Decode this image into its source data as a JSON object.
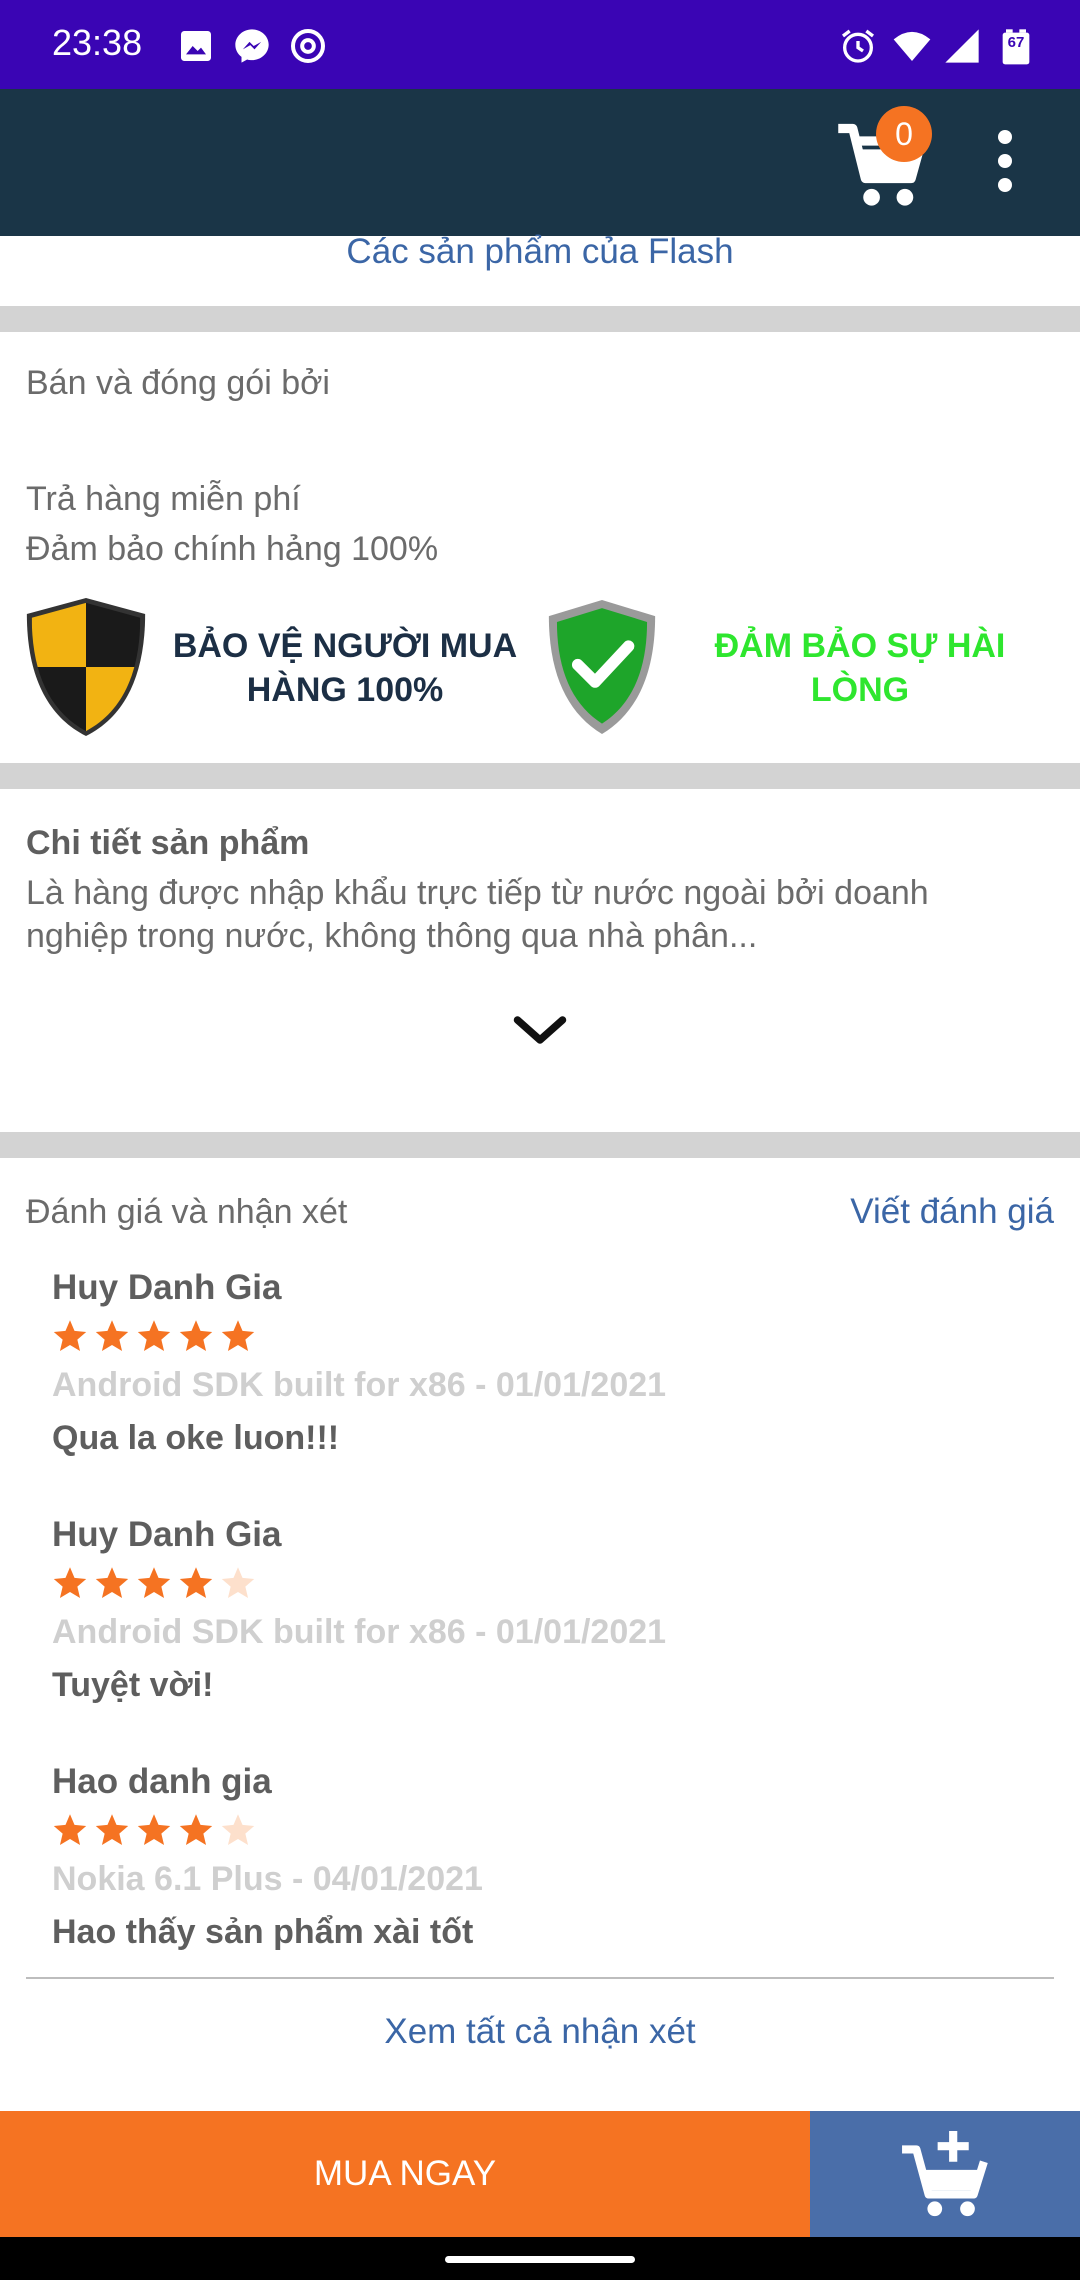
{
  "status_bar": {
    "time": "23:38",
    "battery": "67",
    "background": "#3a05b4"
  },
  "app_bar": {
    "cart_count": "0",
    "background": "#1a3547",
    "badge_color": "#f57322"
  },
  "shop_link": "Các sản phẩm của Flash",
  "seller": {
    "packed_by": "Bán và đóng gói bởi",
    "free_return": "Trả hàng miễn phí",
    "genuine": "Đảm bảo chính hảng 100%"
  },
  "guarantees": {
    "buyer_protection": "BẢO VỆ NGƯỜI MUA HÀNG 100%",
    "satisfaction": "ĐẢM BẢO SỰ HÀI LÒNG"
  },
  "product_detail": {
    "title": "Chi tiết sản phẩm",
    "description": "Là hàng được nhập khẩu trực tiếp từ nước ngoài bởi doanh nghiệp trong nước, không thông qua nhà phân..."
  },
  "reviews": {
    "title": "Đánh giá và nhận xét",
    "write_label": "Viết đánh giá",
    "see_all": "Xem tất cả nhận xét",
    "items": [
      {
        "name": "Huy Danh Gia",
        "rating": 5,
        "meta": "Android SDK built for x86 - 01/01/2021",
        "comment": "Qua la oke luon!!!"
      },
      {
        "name": "Huy Danh Gia",
        "rating": 4,
        "meta": "Android SDK built for x86 - 01/01/2021",
        "comment": "Tuyệt vời!"
      },
      {
        "name": "Hao danh gia",
        "rating": 4,
        "meta": "Nokia 6.1 Plus - 04/01/2021",
        "comment": "Hao thấy sản phẩm xài tốt"
      }
    ]
  },
  "bottom": {
    "buy_now": "MUA NGAY",
    "buy_color": "#f57322",
    "add_cart_color": "#4a6ea9"
  },
  "colors": {
    "star_filled": "#f57322",
    "star_empty": "#fde0cc",
    "link": "#3b66a6"
  }
}
